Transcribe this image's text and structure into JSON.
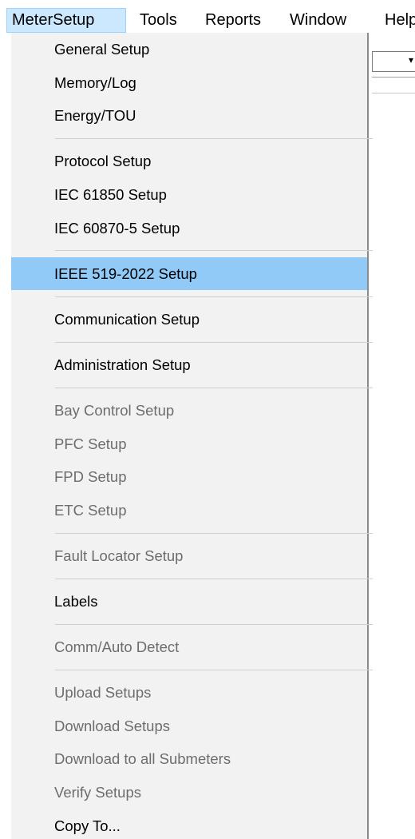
{
  "menubar": {
    "items": [
      {
        "label": "MeterSetup",
        "active": true
      },
      {
        "label": "Tools"
      },
      {
        "label": "Reports"
      },
      {
        "label": "Window"
      },
      {
        "label": "Help"
      }
    ]
  },
  "dropdown": {
    "groups": [
      [
        {
          "label": "General Setup",
          "enabled": true
        },
        {
          "label": "Memory/Log",
          "enabled": true
        },
        {
          "label": "Energy/TOU",
          "enabled": true
        }
      ],
      [
        {
          "label": "Protocol Setup",
          "enabled": true
        },
        {
          "label": "IEC 61850 Setup",
          "enabled": true
        },
        {
          "label": "IEC 60870-5 Setup",
          "enabled": true
        }
      ],
      [
        {
          "label": "IEEE 519-2022 Setup",
          "enabled": true,
          "highlighted": true
        }
      ],
      [
        {
          "label": "Communication Setup",
          "enabled": true
        }
      ],
      [
        {
          "label": "Administration Setup",
          "enabled": true
        }
      ],
      [
        {
          "label": "Bay Control Setup",
          "enabled": false
        },
        {
          "label": "PFC Setup",
          "enabled": false
        },
        {
          "label": "FPD Setup",
          "enabled": false
        },
        {
          "label": "ETC Setup",
          "enabled": false
        }
      ],
      [
        {
          "label": "Fault Locator Setup",
          "enabled": false
        }
      ],
      [
        {
          "label": "Labels",
          "enabled": true
        }
      ],
      [
        {
          "label": "Comm/Auto Detect",
          "enabled": false
        }
      ],
      [
        {
          "label": "Upload Setups",
          "enabled": false
        },
        {
          "label": "Download Setups",
          "enabled": false
        },
        {
          "label": "Download to all Submeters",
          "enabled": false
        },
        {
          "label": "Verify Setups",
          "enabled": false
        },
        {
          "label": "Copy To...",
          "enabled": true
        }
      ]
    ]
  },
  "colors": {
    "highlight": "#91c9f7",
    "menubar_active": "#cce8ff",
    "disabled_text": "#6d6d6d",
    "menu_background": "#f2f2f2"
  }
}
